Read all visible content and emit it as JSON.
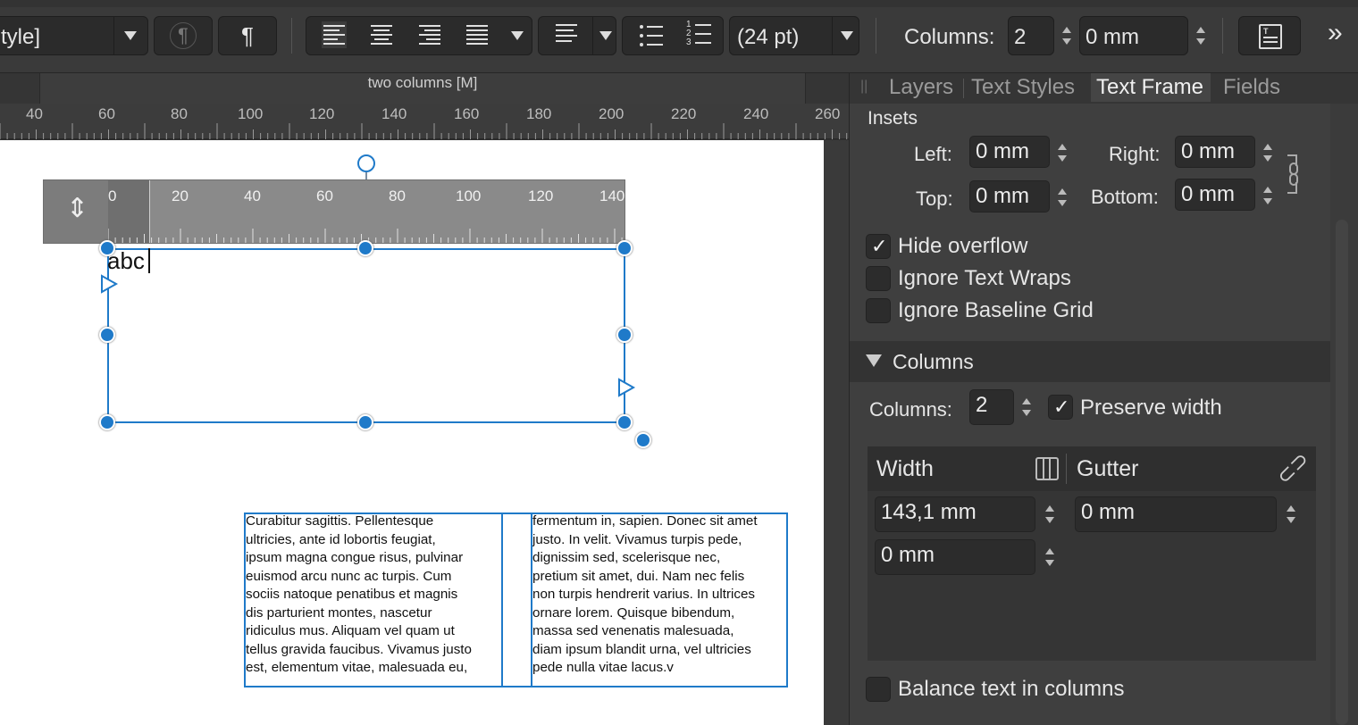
{
  "toolbar": {
    "style_value": "tyle]",
    "paragraph_mark": "¶",
    "paragraph_mark_disabled": "¶",
    "spacing_value": "(24 pt)",
    "columns_label": "Columns:",
    "columns_value": "2",
    "gutter_value": "0 mm",
    "more_label": "»"
  },
  "document": {
    "tab_title": "two columns [M]"
  },
  "ruler": {
    "ticks": [
      "40",
      "60",
      "80",
      "100",
      "120",
      "140",
      "160",
      "180",
      "200",
      "220",
      "240",
      "260"
    ],
    "frame_ticks": [
      "0",
      "20",
      "40",
      "60",
      "80",
      "100",
      "120",
      "140"
    ]
  },
  "canvas": {
    "typed_text": "abc",
    "col1_lines": [
      "Curabitur sagittis. Pellentesque",
      "ultricies, ante id lobortis feugiat,",
      "ipsum magna congue risus, pulvinar",
      "euismod arcu nunc ac turpis. Cum",
      "sociis natoque penatibus et magnis",
      "dis parturient montes, nascetur",
      "ridiculus mus. Aliquam vel quam ut",
      "tellus gravida faucibus. Vivamus justo",
      "est, elementum vitae, malesuada eu,"
    ],
    "col2_lines": [
      "fermentum in, sapien. Donec sit amet",
      "justo. In velit. Vivamus turpis pede,",
      "dignissim sed, scelerisque nec,",
      "pretium sit amet, dui. Nam nec felis",
      "non turpis hendrerit varius. In ultrices",
      "ornare lorem. Quisque bibendum,",
      "massa sed venenatis malesuada,",
      "diam ipsum blandit urna, vel ultricies",
      "pede nulla vitae lacus.v"
    ]
  },
  "panel": {
    "tabs": [
      "Layers",
      "Text Styles",
      "Text Frame",
      "Fields"
    ],
    "active_tab": "Text Frame",
    "insets": {
      "heading": "Insets",
      "left_label": "Left:",
      "left_value": "0 mm",
      "right_label": "Right:",
      "right_value": "0 mm",
      "top_label": "Top:",
      "top_value": "0 mm",
      "bottom_label": "Bottom:",
      "bottom_value": "0 mm"
    },
    "options": {
      "hide_overflow": "Hide overflow",
      "hide_overflow_checked": true,
      "ignore_text_wraps": "Ignore Text Wraps",
      "ignore_baseline_grid": "Ignore Baseline Grid"
    },
    "columns": {
      "heading": "Columns",
      "columns_label": "Columns:",
      "columns_value": "2",
      "preserve_width": "Preserve width",
      "preserve_width_checked": true,
      "width_header": "Width",
      "gutter_header": "Gutter",
      "width_value": "143,1 mm",
      "gutter_value": "0 mm",
      "width_value_2": "0 mm",
      "balance_text": "Balance text in columns"
    }
  },
  "colors": {
    "accent": "#1f7ac9",
    "toolbar_bg": "#3a3a3a",
    "panel_bg": "#3b3b3b",
    "page_bg": "#ffffff"
  }
}
